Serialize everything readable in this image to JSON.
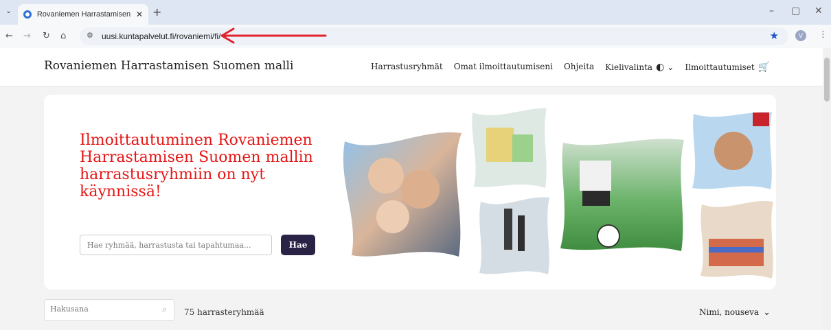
{
  "browser": {
    "tab_title": "Rovaniemen Harrastamisen Suo",
    "url": "uusi.kuntapalvelut.fi/rovaniemi/fi/",
    "avatar_letter": "V",
    "accent_color": "#e0232a"
  },
  "site": {
    "brand": "Rovaniemen Harrastamisen Suomen malli",
    "nav": {
      "groups": "Harrastusryhmät",
      "my_registrations": "Omat ilmoittautumiseni",
      "help": "Ohjeita",
      "language": "Kielivalinta",
      "registrations": "Ilmoittautumiset"
    }
  },
  "hero": {
    "title": "Ilmoittautuminen Rovaniemen Harrastamisen Suomen mallin harrastusryhmiin on nyt käynnissä!",
    "search_placeholder": "Hae ryhmää, harrastusta tai tapahtumaa...",
    "search_button": "Hae"
  },
  "listing": {
    "search_placeholder": "Hakusana",
    "count_text": "75 harrasteryhmää",
    "sort_label": "Nimi, nouseva"
  }
}
